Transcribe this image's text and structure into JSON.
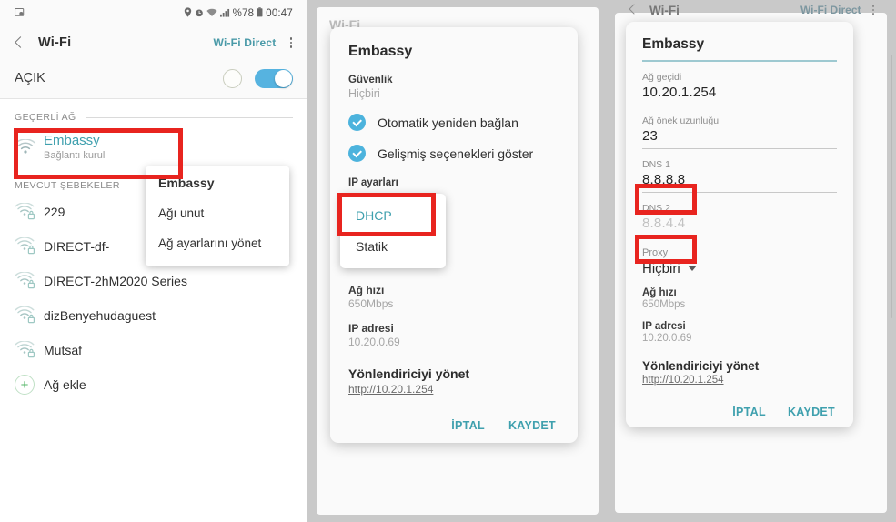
{
  "panel1": {
    "statusbar": {
      "left_icon": "screenshot-icon",
      "icons": [
        "location-icon",
        "alarm-icon",
        "wifi-signal-icon",
        "cell-signal-icon"
      ],
      "battery_percent": "%78",
      "battery_icon": "battery-icon",
      "time": "00:47"
    },
    "appbar": {
      "back_icon": "back-chevron-icon",
      "title": "Wi-Fi",
      "wifi_direct": "Wi-Fi Direct",
      "overflow_icon": "kebab-menu-icon"
    },
    "toggle_row": {
      "label": "AÇIK",
      "toggle_state": "on",
      "toggle_color": "#56b3e0"
    },
    "current_section": {
      "header": "GEÇERLİ AĞ",
      "network": {
        "name": "Embassy",
        "status": "Bağlantı kurul",
        "icon": "wifi-icon",
        "name_color": "#3fa0ae"
      }
    },
    "available_section": {
      "header": "MEVCUT ŞEBEKELER",
      "networks": [
        {
          "name": "229",
          "icon": "wifi-lock-icon"
        },
        {
          "name": "DIRECT-df-",
          "icon": "wifi-lock-icon"
        },
        {
          "name": "DIRECT-2hM2020 Series",
          "icon": "wifi-lock-icon"
        },
        {
          "name": "dizBenyehudaguest",
          "icon": "wifi-lock-icon"
        },
        {
          "name": "Mutsaf",
          "icon": "wifi-lock-icon"
        }
      ],
      "add_network": {
        "label": "Ağ ekle",
        "icon": "plus-circle-icon"
      }
    },
    "context_menu": {
      "title": "Embassy",
      "items": [
        "Ağı unut",
        "Ağ ayarlarını yönet"
      ]
    }
  },
  "panel2": {
    "underlay_title": "Wi-Fi",
    "dialog": {
      "title": "Embassy",
      "security_label": "Güvenlik",
      "security_value": "Hiçbiri",
      "checkboxes": [
        {
          "label": "Otomatik yeniden bağlan",
          "checked": true
        },
        {
          "label": "Gelişmiş seçenekleri göster",
          "checked": true
        }
      ],
      "ip_settings_label": "IP ayarları",
      "dropdown": {
        "options": [
          "DHCP",
          "Statik"
        ],
        "selected": "DHCP"
      },
      "details": [
        {
          "key": "Ağ hızı",
          "value": "650Mbps"
        },
        {
          "key": "IP adresi",
          "value": "10.20.0.69"
        }
      ],
      "router": {
        "title": "Yönlendiriciyi yönet",
        "link": "http://10.20.1.254"
      },
      "cancel_label": "İPTAL",
      "save_label": "KAYDET",
      "action_color": "#3fa0ae"
    }
  },
  "panel3": {
    "underlay": {
      "title": "Wi-Fi",
      "wifi_direct": "Wi-Fi Direct"
    },
    "dialog": {
      "title": "Embassy",
      "fields": [
        {
          "label": "Ağ geçidi",
          "value": "10.20.1.254",
          "placeholder": false
        },
        {
          "label": "Ağ önek uzunluğu",
          "value": "23",
          "placeholder": false
        },
        {
          "label": "DNS 1",
          "value": "8.8.8.8",
          "placeholder": false
        },
        {
          "label": "DNS 2",
          "value": "8.8.4.4",
          "placeholder": true
        }
      ],
      "proxy_label": "Proxy",
      "proxy_value": "Hiçbiri",
      "details": [
        {
          "key": "Ağ hızı",
          "value": "650Mbps"
        },
        {
          "key": "IP adresi",
          "value": "10.20.0.69"
        }
      ],
      "router": {
        "title": "Yönlendiriciyi yönet",
        "link": "http://10.20.1.254"
      },
      "cancel_label": "İPTAL",
      "save_label": "KAYDET"
    }
  },
  "highlight_color": "#e8241f"
}
